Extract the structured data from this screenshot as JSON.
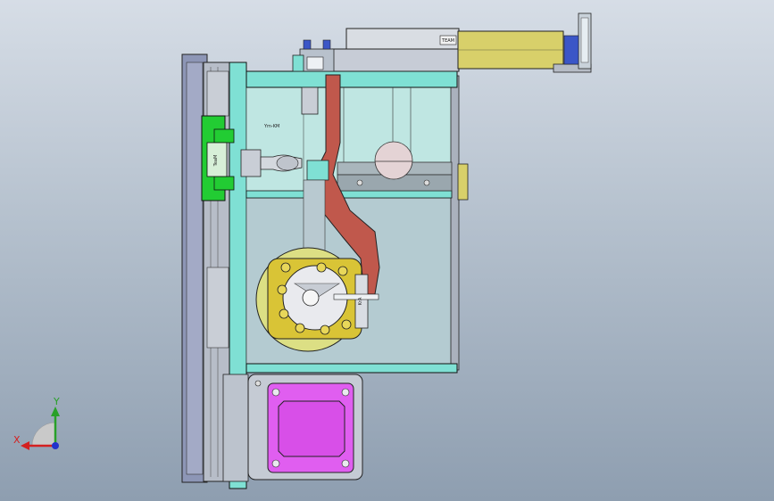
{
  "labels": {
    "top_block": "TEAM",
    "green_block": "TeaM",
    "panel_text": "Ym-KM",
    "mid_block": "KrA"
  },
  "axes": {
    "x": "X",
    "y": "Y"
  },
  "colors": {
    "background_top": "#d6dde6",
    "background_bottom": "#8e9eb0",
    "cyan": "#7fe0d4",
    "green": "#22cc33",
    "red": "#c0584c",
    "khaki": "#d8d06a",
    "magenta": "#e05ef0",
    "frame": "#9aa2b8"
  }
}
